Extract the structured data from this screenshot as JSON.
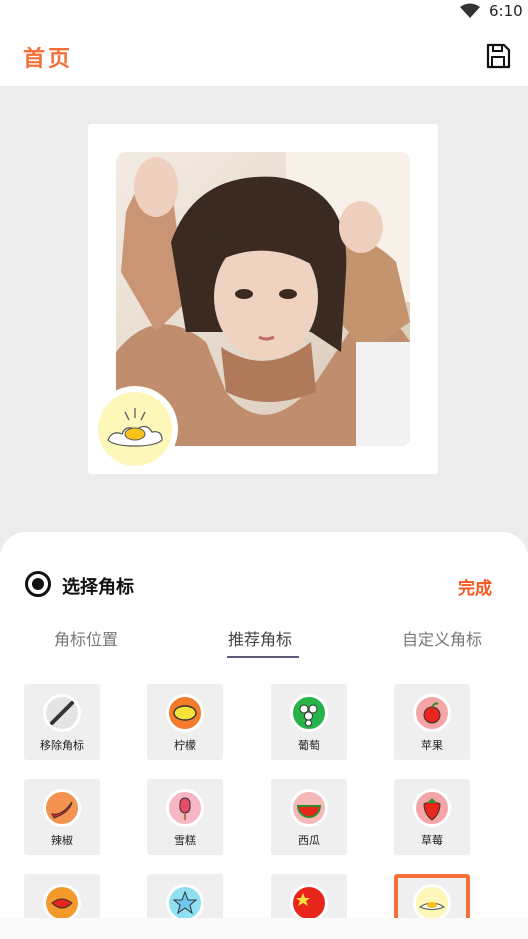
{
  "status_bar": {
    "time": "6:10"
  },
  "app_bar": {
    "title": "首页",
    "save_icon": "save-icon"
  },
  "preview": {
    "badge_icon": "fried-egg-icon"
  },
  "sheet": {
    "title": "选择角标",
    "done_label": "完成",
    "tabs": [
      {
        "label": "角标位置",
        "active": false
      },
      {
        "label": "推荐角标",
        "active": true
      },
      {
        "label": "自定义角标",
        "active": false
      }
    ],
    "items": [
      {
        "label": "移除角标",
        "icon": "remove-icon",
        "bg": "#e4e4e4"
      },
      {
        "label": "柠檬",
        "icon": "lemon-icon",
        "bg": "#f47a2c"
      },
      {
        "label": "葡萄",
        "icon": "grape-icon",
        "bg": "#27b24a"
      },
      {
        "label": "苹果",
        "icon": "apple-icon",
        "bg": "#f4a5a5"
      },
      {
        "label": "辣椒",
        "icon": "chili-icon",
        "bg": "#f49350"
      },
      {
        "label": "雪糕",
        "icon": "popsicle-icon",
        "bg": "#f7b6c4"
      },
      {
        "label": "西瓜",
        "icon": "watermelon-icon",
        "bg": "#f5b8b8"
      },
      {
        "label": "草莓",
        "icon": "strawberry-icon",
        "bg": "#f4a5a5"
      },
      {
        "label": "",
        "icon": "lips-icon",
        "bg": "#f49a2c"
      },
      {
        "label": "",
        "icon": "star-icon",
        "bg": "#8fe0f0"
      },
      {
        "label": "",
        "icon": "china-flag-icon",
        "bg": "#e8261b"
      },
      {
        "label": "",
        "icon": "fried-egg-icon",
        "bg": "#fdf7b9",
        "selected": true
      }
    ]
  }
}
